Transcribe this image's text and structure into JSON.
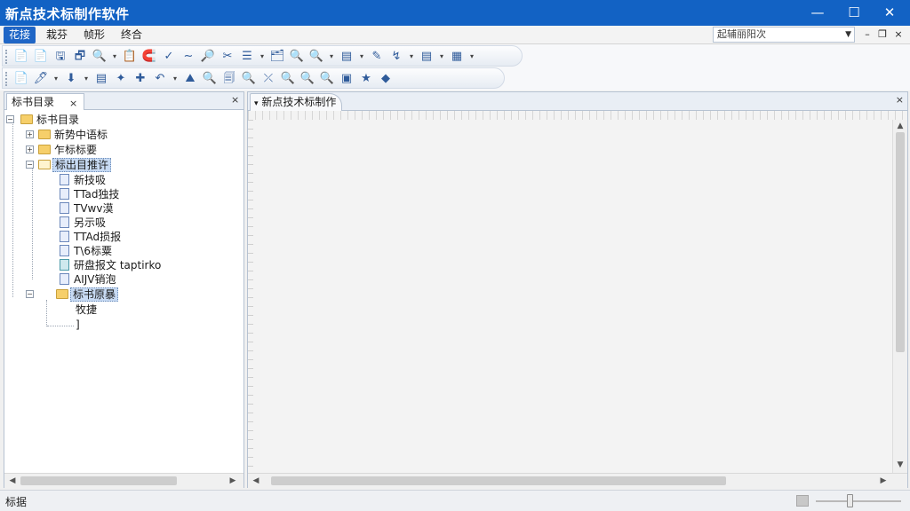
{
  "window": {
    "title": "新点技术标制作软件",
    "minimize": "—",
    "maximize": "☐",
    "close": "✕"
  },
  "menu": {
    "items": [
      "花接",
      "栽芬",
      "帧形",
      "终合"
    ],
    "combo_value": "起辅丽阳次",
    "combo_arrow": "▼",
    "mdi_min": "–",
    "mdi_restore": "❐",
    "mdi_close": "×"
  },
  "toolbar1": {
    "icons": [
      "📄",
      "📄",
      "🖫",
      "🗗",
      "🔍",
      "▾",
      "📋",
      "🧲",
      "✓",
      "∼",
      "🔎",
      "✂",
      "☰",
      "▾",
      "🗂",
      "🔍",
      "🔍",
      "▾",
      "▤",
      "▾",
      "✎",
      "↯",
      "▾",
      "▤",
      "▾",
      "▦",
      "▾"
    ]
  },
  "toolbar2": {
    "icons": [
      "📄",
      "🖊",
      "▾",
      "⬇",
      "▾",
      "▤",
      "✦",
      "✚",
      "↶",
      "▾",
      "⛰",
      "🔍",
      "🗐",
      "🔍",
      "⤫",
      "🔍",
      "🔍",
      "🔍",
      "▣",
      "★",
      "◆"
    ]
  },
  "left_panel": {
    "tab_label": "标书目录",
    "tab_close": "×",
    "pane_close": "×",
    "tree": {
      "root": "标书目录",
      "items": [
        {
          "label": "新势中语标",
          "level": 1,
          "type": "folder"
        },
        {
          "label": "乍标标要",
          "level": 1,
          "type": "folder"
        },
        {
          "label": "标出目推许",
          "level": 1,
          "type": "folder-open"
        },
        {
          "label": "新技吸",
          "level": 2,
          "type": "doc"
        },
        {
          "label": "TTad独技",
          "level": 2,
          "type": "doc"
        },
        {
          "label": "TVwv漠",
          "level": 2,
          "type": "doc"
        },
        {
          "label": "另示吸",
          "level": 2,
          "type": "doc"
        },
        {
          "label": "TTAd损报",
          "level": 2,
          "type": "doc"
        },
        {
          "label": "T\\6标粟",
          "level": 2,
          "type": "doc"
        },
        {
          "label": "研盘报文 taptirko",
          "level": 2,
          "type": "doc-alt"
        },
        {
          "label": "AIJV销泡",
          "level": 2,
          "type": "doc"
        },
        {
          "label": "标书原暴",
          "level": 1,
          "type": "folder"
        },
        {
          "label": "牧捷",
          "level": 2,
          "type": "plain"
        },
        {
          "label": "]",
          "level": 2,
          "type": "plain"
        }
      ]
    },
    "scroll_left": "◀",
    "scroll_right": "▶"
  },
  "document": {
    "tab_label": "新点技术标制作",
    "tab_prefix": "▾",
    "tab_close": "×",
    "scroll_left": "◀",
    "scroll_right": "▶",
    "scroll_up": "▲",
    "scroll_down": "▼"
  },
  "status": {
    "text": "标据",
    "zoom_level": 0.4
  }
}
